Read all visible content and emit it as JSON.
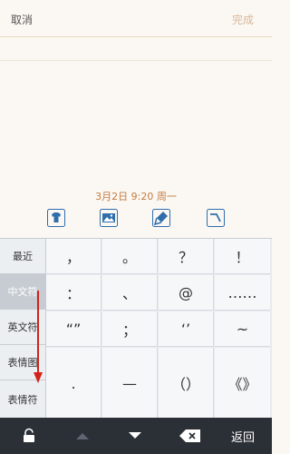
{
  "topbar": {
    "cancel_label": "取消",
    "done_label": "完成"
  },
  "note": {
    "datetime": "3月2日 9:20 周一",
    "tools": [
      "shirt-icon",
      "image-icon",
      "tag-icon",
      "pen-icon"
    ]
  },
  "keyboard": {
    "categories": [
      {
        "label": "最近"
      },
      {
        "label": "中文符"
      },
      {
        "label": "英文符"
      },
      {
        "label": "表情图"
      },
      {
        "label": "表情符"
      }
    ],
    "active_category": "中文符",
    "keys": [
      [
        "，",
        "。",
        "？",
        "！"
      ],
      [
        "：",
        "、",
        "@",
        "……"
      ],
      [
        "“”",
        "；",
        "‘’",
        "~"
      ],
      [
        ".",
        "—",
        "（）",
        "《》"
      ]
    ]
  },
  "bottombar": {
    "back_label": "返回"
  },
  "colors": {
    "accent": "#c57b40",
    "tool_icons": "#2f6eac",
    "bottom_bar": "#2b2f36",
    "arrow": "#d6201a"
  }
}
